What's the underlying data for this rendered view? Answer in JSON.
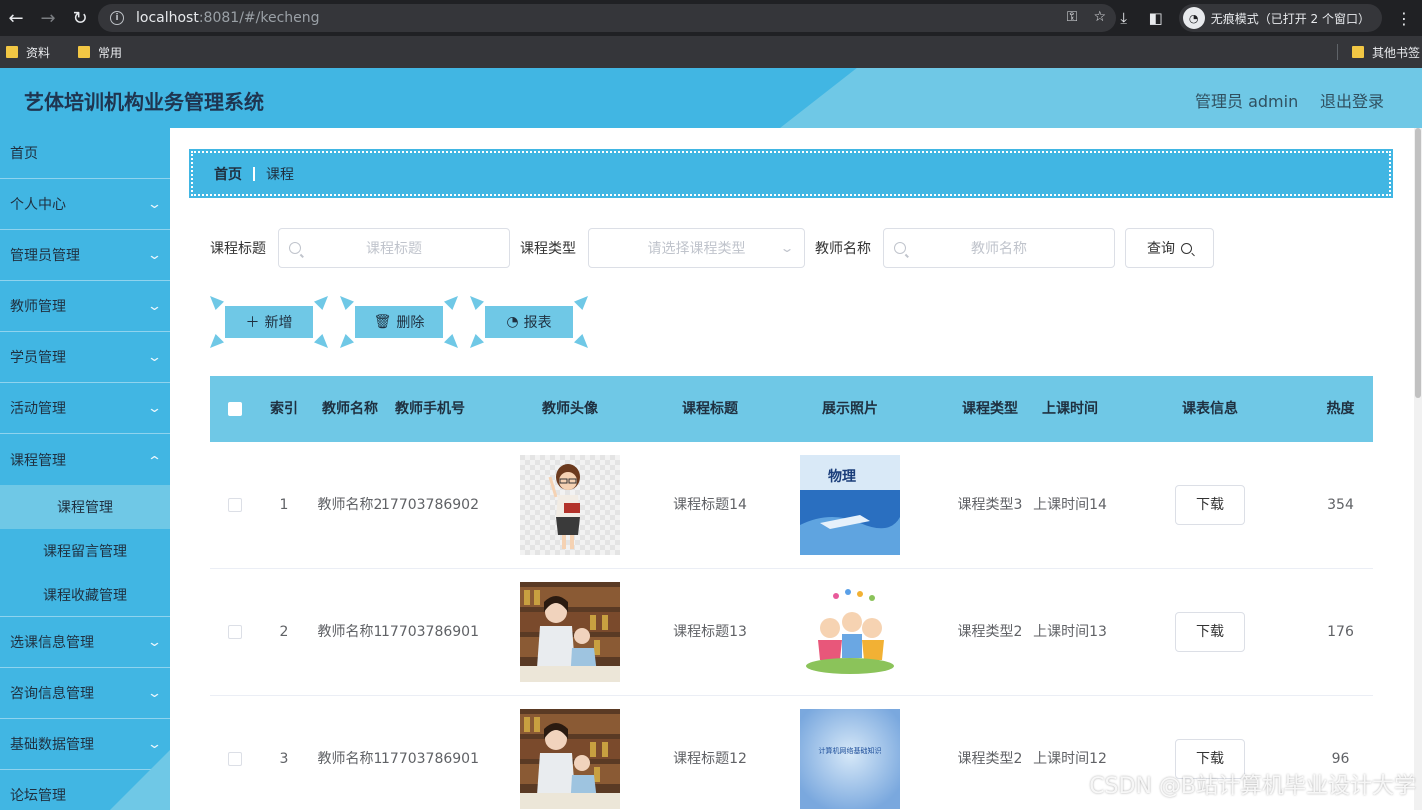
{
  "browser": {
    "url_host": "localhost",
    "url_rest": ":8081/#/kecheng",
    "incognito_label": "无痕模式（已打开 2 个窗口）",
    "bookmarks": [
      "资料",
      "常用"
    ],
    "other_bookmarks": "其他书签"
  },
  "header": {
    "title": "艺体培训机构业务管理系统",
    "user": "管理员 admin",
    "logout": "退出登录"
  },
  "sidebar": {
    "items": [
      {
        "label": "首页"
      },
      {
        "label": "个人中心"
      },
      {
        "label": "管理员管理"
      },
      {
        "label": "教师管理"
      },
      {
        "label": "学员管理"
      },
      {
        "label": "活动管理"
      },
      {
        "label": "课程管理"
      }
    ],
    "subitems": [
      {
        "label": "课程管理"
      },
      {
        "label": "课程留言管理"
      },
      {
        "label": "课程收藏管理"
      }
    ],
    "items_after": [
      {
        "label": "选课信息管理"
      },
      {
        "label": "咨询信息管理"
      },
      {
        "label": "基础数据管理"
      },
      {
        "label": "论坛管理"
      }
    ]
  },
  "breadcrumb": {
    "home": "首页",
    "current": "课程"
  },
  "search": {
    "title_label": "课程标题",
    "title_placeholder": "课程标题",
    "type_label": "课程类型",
    "type_placeholder": "请选择课程类型",
    "teacher_label": "教师名称",
    "teacher_placeholder": "教师名称",
    "query_label": "查询"
  },
  "actions": {
    "add": "新增",
    "delete": "删除",
    "report": "报表"
  },
  "table": {
    "headers": [
      "索引",
      "教师名称",
      "教师手机号",
      "教师头像",
      "课程标题",
      "展示照片",
      "课程类型",
      "上课时间",
      "课表信息",
      "热度"
    ],
    "download_label": "下载",
    "rows": [
      {
        "index": "1",
        "teacher": "教师名称2",
        "phone": "17703786902",
        "title": "课程标题14",
        "type": "课程类型3",
        "time": "上课时间14",
        "heat": "354"
      },
      {
        "index": "2",
        "teacher": "教师名称1",
        "phone": "17703786901",
        "title": "课程标题13",
        "type": "课程类型2",
        "time": "上课时间13",
        "heat": "176"
      },
      {
        "index": "3",
        "teacher": "教师名称1",
        "phone": "17703786901",
        "title": "课程标题12",
        "type": "课程类型2",
        "time": "上课时间12",
        "heat": "96"
      }
    ]
  },
  "photo_texts": {
    "book_title": "物理",
    "network_book": "计算机网络基础知识"
  },
  "watermark": "CSDN @B站计算机毕业设计大学",
  "colors": {
    "accent": "#41b6e3",
    "accent_light": "#6fc8e6"
  }
}
